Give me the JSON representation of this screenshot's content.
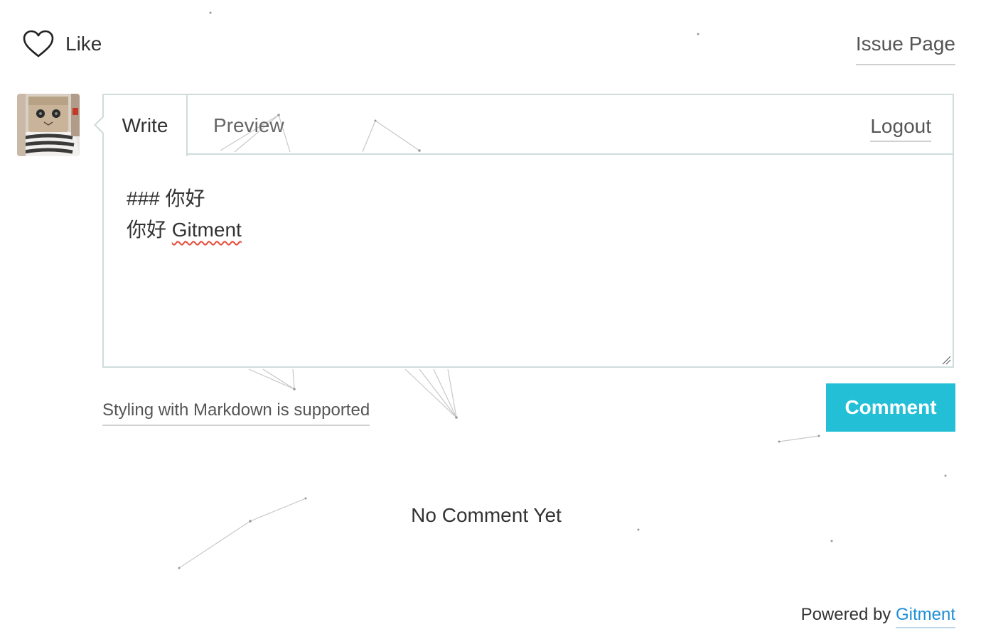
{
  "header": {
    "like_label": "Like",
    "issue_page_label": "Issue Page"
  },
  "editor": {
    "tabs": [
      {
        "label": "Write",
        "active": true
      },
      {
        "label": "Preview",
        "active": false
      }
    ],
    "logout_label": "Logout",
    "content_line1": "### 你好",
    "content_line2_prefix": "你好 ",
    "content_line2_word": "Gitment"
  },
  "markdown_tip": "Styling with Markdown is supported",
  "comment_button_label": "Comment",
  "no_comment_text": "No Comment Yet",
  "footer": {
    "powered_by": "Powered by ",
    "link_label": "Gitment"
  },
  "colors": {
    "accent": "#23bfd6",
    "link": "#1e8fd6",
    "border": "#cfdcdc",
    "spellcheck": "#e74c3c"
  },
  "icons": {
    "like": "heart-icon",
    "resize": "resize-handle-icon"
  }
}
